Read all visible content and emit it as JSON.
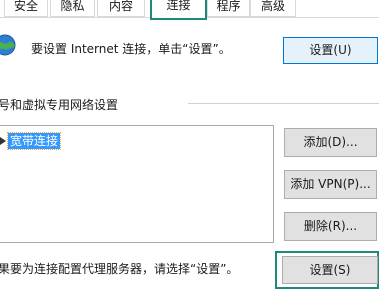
{
  "tabs": [
    {
      "label": "安全",
      "active": false
    },
    {
      "label": "隐私",
      "active": false
    },
    {
      "label": "内容",
      "active": false
    },
    {
      "label": "连接",
      "active": true
    },
    {
      "label": "程序",
      "active": false
    },
    {
      "label": "高级",
      "active": false
    }
  ],
  "internet": {
    "description": "要设置 Internet 连接，单击“设置”。",
    "setup_button": "设置(U)"
  },
  "vpn_group": {
    "label": "号和虚拟专用网络设置",
    "items": [
      {
        "label": "宽带连接",
        "selected": true
      }
    ],
    "add_button": "添加(D)...",
    "add_vpn_button": "添加 VPN(P)...",
    "delete_button": "删除(R)..."
  },
  "proxy": {
    "description": "果要为连接配置代理服务器，请选择“设置”。",
    "settings_button": "设置(S)"
  },
  "colors": {
    "highlight_border": "#1e8a7e",
    "selection": "#3399ff",
    "button_face": "#e1e1e1"
  }
}
